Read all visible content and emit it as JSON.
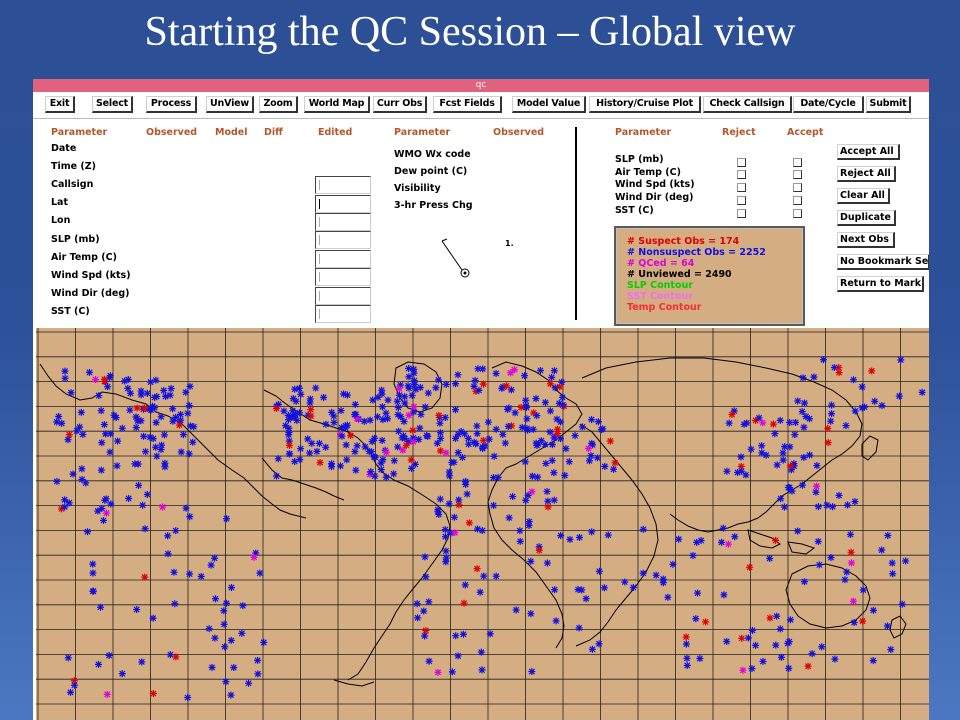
{
  "slide_title": "Starting the QC Session – Global view",
  "window_title": "qc",
  "toolbar": [
    "Exit",
    "Select",
    "Process",
    "UnView",
    "Zoom",
    "World Map",
    "Curr Obs",
    "Fcst Fields",
    "Model Value",
    "History/Cruise Plot",
    "Check Callsign",
    "Date/Cycle",
    "Submit"
  ],
  "obs_panel": {
    "headers": {
      "parameter": "Parameter",
      "observed": "Observed",
      "model": "Model",
      "diff": "Diff",
      "edited": "Edited"
    },
    "rows": [
      "Date",
      "Time (Z)",
      "Callsign",
      "Lat",
      "Lon",
      "SLP (mb)",
      "Air Temp (C)",
      "Wind Spd (kts)",
      "Wind Dir (deg)",
      "SST (C)"
    ]
  },
  "wx_panel": {
    "headers": {
      "parameter": "Parameter",
      "observed": "Observed"
    },
    "rows": [
      "WMO Wx code",
      "Dew point (C)",
      "Visibility",
      "3-hr Press Chg"
    ],
    "station_value": "1."
  },
  "reject_panel": {
    "headers": {
      "parameter": "Parameter",
      "reject": "Reject",
      "accept": "Accept"
    },
    "rows": [
      "SLP (mb)",
      "Air Temp (C)",
      "Wind Spd (kts)",
      "Wind Dir (deg)",
      "SST (C)"
    ]
  },
  "side_buttons": [
    "Accept All",
    "Reject All",
    "Clear All",
    "Duplicate",
    "Next Obs",
    "No Bookmark Se",
    "Return to Mark"
  ],
  "legend": {
    "items": [
      {
        "text": "# Suspect Obs = 174",
        "color": "#e00000"
      },
      {
        "text": "# Nonsuspect Obs = 2252",
        "color": "#1010e0"
      },
      {
        "text": "# QCed = 64",
        "color": "#e000e0"
      },
      {
        "text": "# Unviewed = 2490",
        "color": "#000000"
      },
      {
        "text": "SLP Contour",
        "color": "#00d000"
      },
      {
        "text": "SST Contour",
        "color": "#f070f0"
      },
      {
        "text": "Temp Contour",
        "color": "#f03030"
      }
    ]
  },
  "colors": {
    "map_bg": "#d4ad82",
    "header_text": "#b5562b",
    "nonsuspect": "#1010e0",
    "suspect": "#e00000",
    "qced": "#e000e0"
  }
}
